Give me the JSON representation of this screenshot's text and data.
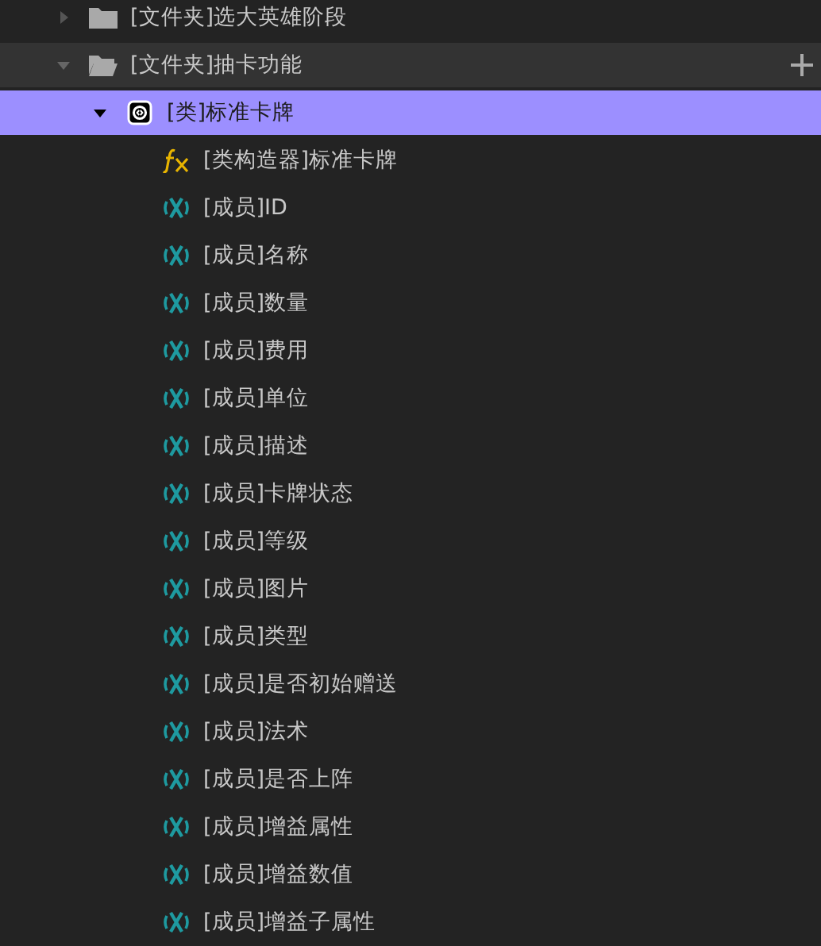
{
  "tree": [
    {
      "kind": "folder",
      "label": "[文件夹]选大英雄阶段",
      "expanded": false,
      "selected": false,
      "hovered": false
    },
    {
      "kind": "folder",
      "label": "[文件夹]抽卡功能",
      "expanded": true,
      "selected": false,
      "hovered": true,
      "children": [
        {
          "kind": "class",
          "label": "[类]标准卡牌",
          "expanded": true,
          "selected": true,
          "hovered": false,
          "children": [
            {
              "kind": "constructor",
              "label": "[类构造器]标准卡牌",
              "selected": false,
              "hovered": false
            },
            {
              "kind": "member",
              "label": "[成员]ID",
              "selected": false,
              "hovered": false
            },
            {
              "kind": "member",
              "label": "[成员]名称",
              "selected": false,
              "hovered": false
            },
            {
              "kind": "member",
              "label": "[成员]数量",
              "selected": false,
              "hovered": false
            },
            {
              "kind": "member",
              "label": "[成员]费用",
              "selected": false,
              "hovered": false
            },
            {
              "kind": "member",
              "label": "[成员]单位",
              "selected": false,
              "hovered": false
            },
            {
              "kind": "member",
              "label": "[成员]描述",
              "selected": false,
              "hovered": false
            },
            {
              "kind": "member",
              "label": "[成员]卡牌状态",
              "selected": false,
              "hovered": false
            },
            {
              "kind": "member",
              "label": "[成员]等级",
              "selected": false,
              "hovered": false
            },
            {
              "kind": "member",
              "label": "[成员]图片",
              "selected": false,
              "hovered": false
            },
            {
              "kind": "member",
              "label": "[成员]类型",
              "selected": false,
              "hovered": false
            },
            {
              "kind": "member",
              "label": "[成员]是否初始赠送",
              "selected": false,
              "hovered": false
            },
            {
              "kind": "member",
              "label": "[成员]法术",
              "selected": false,
              "hovered": false
            },
            {
              "kind": "member",
              "label": "[成员]是否上阵",
              "selected": false,
              "hovered": false
            },
            {
              "kind": "member",
              "label": "[成员]增益属性",
              "selected": false,
              "hovered": false
            },
            {
              "kind": "member",
              "label": "[成员]增益数值",
              "selected": false,
              "hovered": false
            },
            {
              "kind": "member",
              "label": "[成员]增益子属性",
              "selected": false,
              "hovered": false
            }
          ]
        }
      ]
    }
  ]
}
